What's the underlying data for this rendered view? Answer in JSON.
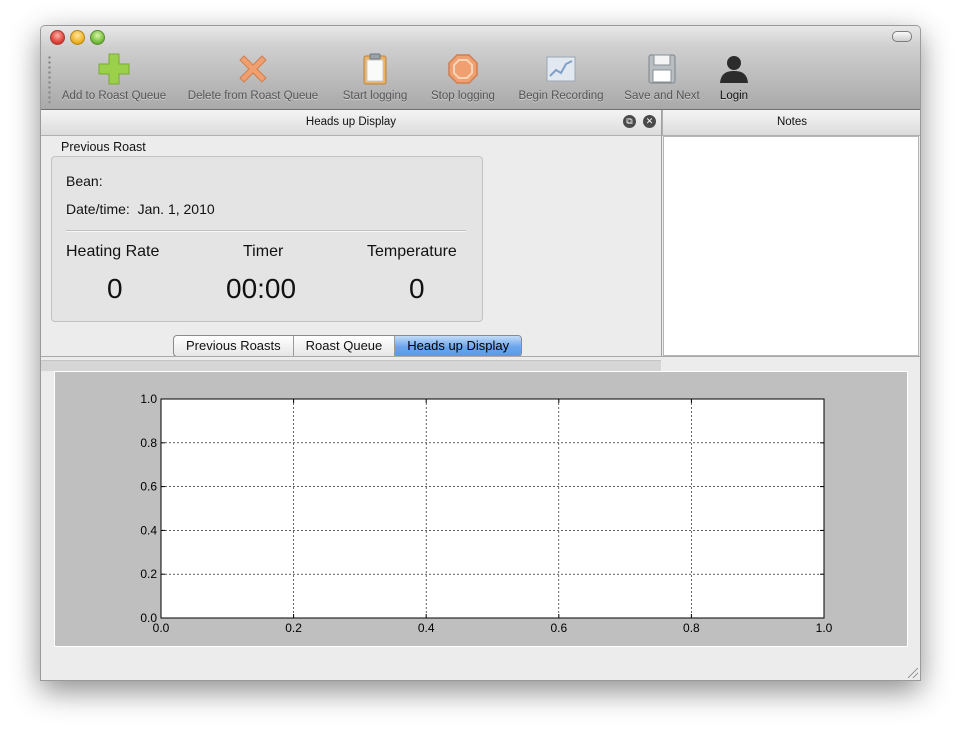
{
  "toolbar": {
    "items": [
      {
        "label": "Add to Roast Queue",
        "icon": "plus-icon"
      },
      {
        "label": "Delete from Roast Queue",
        "icon": "x-icon"
      },
      {
        "label": "Start logging",
        "icon": "clipboard-icon"
      },
      {
        "label": "Stop logging",
        "icon": "stop-icon"
      },
      {
        "label": "Begin Recording",
        "icon": "chart-icon"
      },
      {
        "label": "Save and Next",
        "icon": "floppy-disk-icon"
      },
      {
        "label": "Login",
        "icon": "user-icon"
      }
    ]
  },
  "hud": {
    "title": "Heads up Display",
    "group_title": "Previous Roast",
    "bean_label": "Bean:",
    "bean_value": "",
    "date_label": "Date/time:",
    "date_value": "Jan. 1, 2010",
    "heating_rate_label": "Heating Rate",
    "heating_rate_value": "0",
    "timer_label": "Timer",
    "timer_value": "00:00",
    "temperature_label": "Temperature",
    "temperature_value": "0"
  },
  "notes": {
    "title": "Notes",
    "value": ""
  },
  "tabs": [
    {
      "label": "Previous Roasts",
      "active": false
    },
    {
      "label": "Roast Queue",
      "active": false
    },
    {
      "label": "Heads up Display",
      "active": true
    }
  ],
  "plot": {
    "xticks": [
      "0.0",
      "0.2",
      "0.4",
      "0.6",
      "0.8",
      "1.0"
    ],
    "yticks": [
      "0.0",
      "0.2",
      "0.4",
      "0.6",
      "0.8",
      "1.0"
    ],
    "xlim": [
      0,
      1
    ],
    "ylim": [
      0,
      1
    ],
    "grid": true,
    "series": []
  },
  "colors": {
    "active_tab": "#6aa6ec",
    "plot_background": "#bfbfbf"
  }
}
